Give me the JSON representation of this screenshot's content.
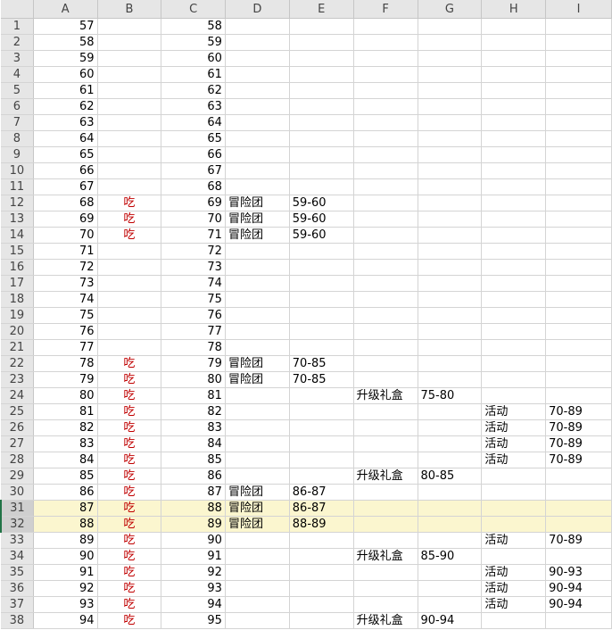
{
  "columns": [
    "A",
    "B",
    "C",
    "D",
    "E",
    "F",
    "G",
    "H",
    "I"
  ],
  "rows": [
    {
      "n": "1",
      "A": "57",
      "B": "",
      "C": "58",
      "D": "",
      "E": "",
      "F": "",
      "G": "",
      "H": "",
      "I": ""
    },
    {
      "n": "2",
      "A": "58",
      "B": "",
      "C": "59",
      "D": "",
      "E": "",
      "F": "",
      "G": "",
      "H": "",
      "I": ""
    },
    {
      "n": "3",
      "A": "59",
      "B": "",
      "C": "60",
      "D": "",
      "E": "",
      "F": "",
      "G": "",
      "H": "",
      "I": ""
    },
    {
      "n": "4",
      "A": "60",
      "B": "",
      "C": "61",
      "D": "",
      "E": "",
      "F": "",
      "G": "",
      "H": "",
      "I": ""
    },
    {
      "n": "5",
      "A": "61",
      "B": "",
      "C": "62",
      "D": "",
      "E": "",
      "F": "",
      "G": "",
      "H": "",
      "I": ""
    },
    {
      "n": "6",
      "A": "62",
      "B": "",
      "C": "63",
      "D": "",
      "E": "",
      "F": "",
      "G": "",
      "H": "",
      "I": ""
    },
    {
      "n": "7",
      "A": "63",
      "B": "",
      "C": "64",
      "D": "",
      "E": "",
      "F": "",
      "G": "",
      "H": "",
      "I": ""
    },
    {
      "n": "8",
      "A": "64",
      "B": "",
      "C": "65",
      "D": "",
      "E": "",
      "F": "",
      "G": "",
      "H": "",
      "I": ""
    },
    {
      "n": "9",
      "A": "65",
      "B": "",
      "C": "66",
      "D": "",
      "E": "",
      "F": "",
      "G": "",
      "H": "",
      "I": ""
    },
    {
      "n": "10",
      "A": "66",
      "B": "",
      "C": "67",
      "D": "",
      "E": "",
      "F": "",
      "G": "",
      "H": "",
      "I": ""
    },
    {
      "n": "11",
      "A": "67",
      "B": "",
      "C": "68",
      "D": "",
      "E": "",
      "F": "",
      "G": "",
      "H": "",
      "I": ""
    },
    {
      "n": "12",
      "A": "68",
      "B": "吃",
      "C": "69",
      "D": "冒险团",
      "E": "59-60",
      "F": "",
      "G": "",
      "H": "",
      "I": ""
    },
    {
      "n": "13",
      "A": "69",
      "B": "吃",
      "C": "70",
      "D": "冒险团",
      "E": "59-60",
      "F": "",
      "G": "",
      "H": "",
      "I": ""
    },
    {
      "n": "14",
      "A": "70",
      "B": "吃",
      "C": "71",
      "D": "冒险团",
      "E": "59-60",
      "F": "",
      "G": "",
      "H": "",
      "I": ""
    },
    {
      "n": "15",
      "A": "71",
      "B": "",
      "C": "72",
      "D": "",
      "E": "",
      "F": "",
      "G": "",
      "H": "",
      "I": ""
    },
    {
      "n": "16",
      "A": "72",
      "B": "",
      "C": "73",
      "D": "",
      "E": "",
      "F": "",
      "G": "",
      "H": "",
      "I": ""
    },
    {
      "n": "17",
      "A": "73",
      "B": "",
      "C": "74",
      "D": "",
      "E": "",
      "F": "",
      "G": "",
      "H": "",
      "I": ""
    },
    {
      "n": "18",
      "A": "74",
      "B": "",
      "C": "75",
      "D": "",
      "E": "",
      "F": "",
      "G": "",
      "H": "",
      "I": ""
    },
    {
      "n": "19",
      "A": "75",
      "B": "",
      "C": "76",
      "D": "",
      "E": "",
      "F": "",
      "G": "",
      "H": "",
      "I": ""
    },
    {
      "n": "20",
      "A": "76",
      "B": "",
      "C": "77",
      "D": "",
      "E": "",
      "F": "",
      "G": "",
      "H": "",
      "I": ""
    },
    {
      "n": "21",
      "A": "77",
      "B": "",
      "C": "78",
      "D": "",
      "E": "",
      "F": "",
      "G": "",
      "H": "",
      "I": ""
    },
    {
      "n": "22",
      "A": "78",
      "B": "吃",
      "C": "79",
      "D": "冒险团",
      "E": "70-85",
      "F": "",
      "G": "",
      "H": "",
      "I": ""
    },
    {
      "n": "23",
      "A": "79",
      "B": "吃",
      "C": "80",
      "D": "冒险团",
      "E": "70-85",
      "F": "",
      "G": "",
      "H": "",
      "I": ""
    },
    {
      "n": "24",
      "A": "80",
      "B": "吃",
      "C": "81",
      "D": "",
      "E": "",
      "F": "升级礼盒",
      "G": "75-80",
      "H": "",
      "I": ""
    },
    {
      "n": "25",
      "A": "81",
      "B": "吃",
      "C": "82",
      "D": "",
      "E": "",
      "F": "",
      "G": "",
      "H": "活动",
      "I": "70-89"
    },
    {
      "n": "26",
      "A": "82",
      "B": "吃",
      "C": "83",
      "D": "",
      "E": "",
      "F": "",
      "G": "",
      "H": "活动",
      "I": "70-89"
    },
    {
      "n": "27",
      "A": "83",
      "B": "吃",
      "C": "84",
      "D": "",
      "E": "",
      "F": "",
      "G": "",
      "H": "活动",
      "I": "70-89"
    },
    {
      "n": "28",
      "A": "84",
      "B": "吃",
      "C": "85",
      "D": "",
      "E": "",
      "F": "",
      "G": "",
      "H": "活动",
      "I": "70-89"
    },
    {
      "n": "29",
      "A": "85",
      "B": "吃",
      "C": "86",
      "D": "",
      "E": "",
      "F": "升级礼盒",
      "G": "80-85",
      "H": "",
      "I": ""
    },
    {
      "n": "30",
      "A": "86",
      "B": "吃",
      "C": "87",
      "D": "冒险团",
      "E": "86-87",
      "F": "",
      "G": "",
      "H": "",
      "I": ""
    },
    {
      "n": "31",
      "A": "87",
      "B": "吃",
      "C": "88",
      "D": "冒险团",
      "E": "86-87",
      "F": "",
      "G": "",
      "H": "",
      "I": "",
      "sel": true
    },
    {
      "n": "32",
      "A": "88",
      "B": "吃",
      "C": "89",
      "D": "冒险团",
      "E": "88-89",
      "F": "",
      "G": "",
      "H": "",
      "I": "",
      "sel": true
    },
    {
      "n": "33",
      "A": "89",
      "B": "吃",
      "C": "90",
      "D": "",
      "E": "",
      "F": "",
      "G": "",
      "H": "活动",
      "I": "70-89"
    },
    {
      "n": "34",
      "A": "90",
      "B": "吃",
      "C": "91",
      "D": "",
      "E": "",
      "F": "升级礼盒",
      "G": "85-90",
      "H": "",
      "I": ""
    },
    {
      "n": "35",
      "A": "91",
      "B": "吃",
      "C": "92",
      "D": "",
      "E": "",
      "F": "",
      "G": "",
      "H": "活动",
      "I": "90-93"
    },
    {
      "n": "36",
      "A": "92",
      "B": "吃",
      "C": "93",
      "D": "",
      "E": "",
      "F": "",
      "G": "",
      "H": "活动",
      "I": "90-94"
    },
    {
      "n": "37",
      "A": "93",
      "B": "吃",
      "C": "94",
      "D": "",
      "E": "",
      "F": "",
      "G": "",
      "H": "活动",
      "I": "90-94"
    },
    {
      "n": "38",
      "A": "94",
      "B": "吃",
      "C": "95",
      "D": "",
      "E": "",
      "F": "升级礼盒",
      "G": "90-94",
      "H": "",
      "I": ""
    }
  ],
  "colors": {
    "highlight": "#fbf6cf",
    "red_text": "#c00000",
    "header_bg": "#e6e6e6",
    "accent": "#217346"
  }
}
